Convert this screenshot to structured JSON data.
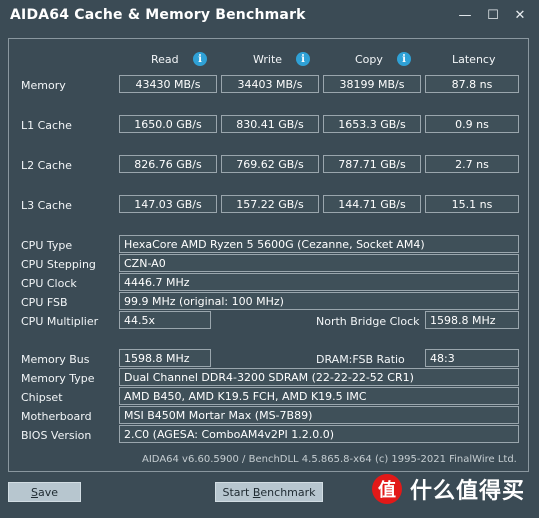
{
  "window": {
    "title": "AIDA64 Cache & Memory Benchmark",
    "minimize_glyph": "—",
    "maximize_glyph": "☐",
    "close_glyph": "✕"
  },
  "columns": {
    "read": "Read",
    "write": "Write",
    "copy": "Copy",
    "latency": "Latency",
    "info_glyph": "i"
  },
  "benchmarks": [
    {
      "label": "Memory",
      "read": "43430 MB/s",
      "write": "34403 MB/s",
      "copy": "38199 MB/s",
      "latency": "87.8 ns"
    },
    {
      "label": "L1 Cache",
      "read": "1650.0 GB/s",
      "write": "830.41 GB/s",
      "copy": "1653.3 GB/s",
      "latency": "0.9 ns"
    },
    {
      "label": "L2 Cache",
      "read": "826.76 GB/s",
      "write": "769.62 GB/s",
      "copy": "787.71 GB/s",
      "latency": "2.7 ns"
    },
    {
      "label": "L3 Cache",
      "read": "147.03 GB/s",
      "write": "157.22 GB/s",
      "copy": "144.71 GB/s",
      "latency": "15.1 ns"
    }
  ],
  "cpu": {
    "type_label": "CPU Type",
    "type_value": "HexaCore AMD Ryzen 5 5600G  (Cezanne, Socket AM4)",
    "stepping_label": "CPU Stepping",
    "stepping_value": "CZN-A0",
    "clock_label": "CPU Clock",
    "clock_value": "4446.7 MHz",
    "fsb_label": "CPU FSB",
    "fsb_value": "99.9 MHz  (original: 100 MHz)",
    "multiplier_label": "CPU Multiplier",
    "multiplier_value": "44.5x",
    "nb_clock_label": "North Bridge Clock",
    "nb_clock_value": "1598.8 MHz"
  },
  "memory": {
    "bus_label": "Memory Bus",
    "bus_value": "1598.8 MHz",
    "ratio_label": "DRAM:FSB Ratio",
    "ratio_value": "48:3",
    "type_label": "Memory Type",
    "type_value": "Dual Channel DDR4-3200 SDRAM  (22-22-22-52 CR1)",
    "chipset_label": "Chipset",
    "chipset_value": "AMD B450, AMD K19.5 FCH, AMD K19.5 IMC",
    "motherboard_label": "Motherboard",
    "motherboard_value": "MSI B450M Mortar Max (MS-7B89)",
    "bios_label": "BIOS Version",
    "bios_value": "2.C0  (AGESA: ComboAM4v2PI 1.2.0.0)"
  },
  "footer": {
    "version": "AIDA64 v6.60.5900 / BenchDLL 4.5.865.8-x64  (c) 1995-2021 FinalWire Ltd."
  },
  "buttons": {
    "save_mnemonic": "S",
    "save_rest": "ave",
    "start_prefix": "Start ",
    "start_mnemonic": "B",
    "start_rest": "enchmark"
  },
  "watermark": {
    "logo_glyph": "值",
    "text": "什么值得买"
  },
  "colors": {
    "background": "#3b4b55",
    "field": "#3f5059",
    "info_icon": "#2fa1d6",
    "button": "#b7c6cf",
    "watermark_logo": "#e21918"
  }
}
